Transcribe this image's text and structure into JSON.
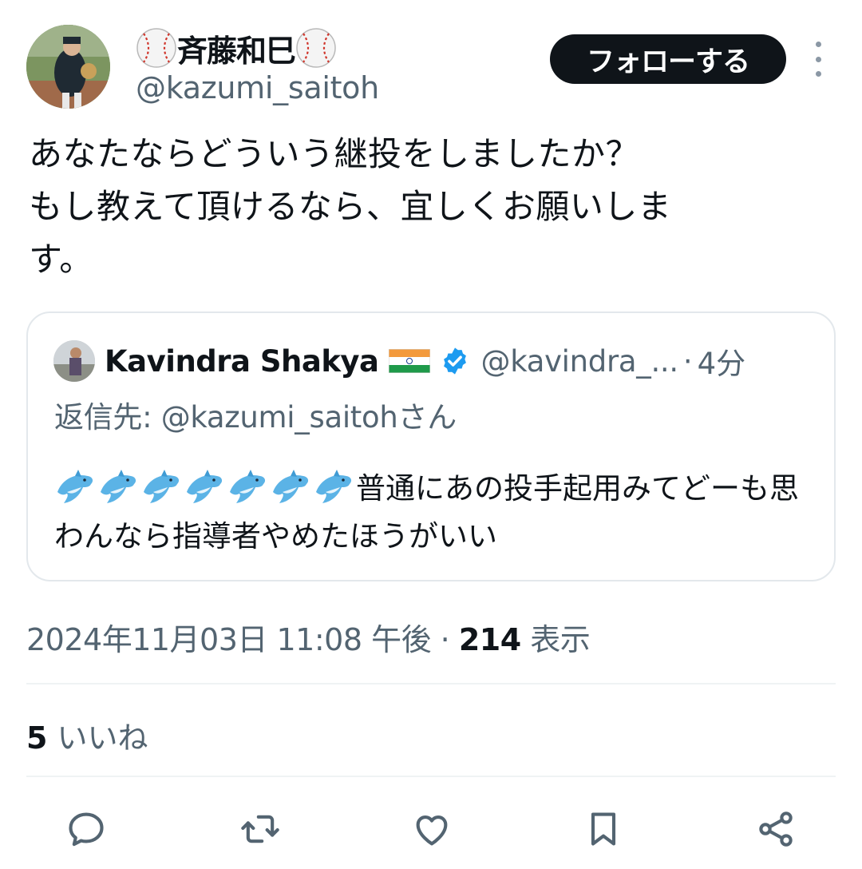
{
  "author": {
    "name": "斉藤和巳",
    "name_prefix_icon": "baseball-icon",
    "name_suffix_icon": "baseball-icon",
    "handle": "@kazumi_saitoh"
  },
  "follow_button": {
    "label": "フォローする"
  },
  "more_menu": {
    "icon": "more-vertical-icon"
  },
  "tweet": {
    "text": "あなたならどういう継投をしましたか？\nもし教えて頂けるなら、宜しくお願いしま\nす。"
  },
  "quote": {
    "name": "Kavindra Shakya",
    "flag_icon": "india-flag-icon",
    "verified_icon": "verified-badge-icon",
    "handle": "@kavindra_...",
    "separator": "·",
    "time": "4分",
    "reply_to": "返信先: @kazumi_saitohさん",
    "emoji_icon": "dolphin-icon",
    "emoji_count": 7,
    "text": "普通にあの投手起用みてどーも思わんなら指導者やめたほうがいい"
  },
  "meta": {
    "datetime": "2024年11月03日 11:08 午後",
    "separator": " · ",
    "views_count": "214",
    "views_label": " 表示"
  },
  "likes": {
    "count": "5",
    "label": " いいね"
  },
  "actions": [
    "reply-icon",
    "retweet-icon",
    "like-icon",
    "bookmark-icon",
    "share-icon"
  ],
  "colors": {
    "text": "#0f1419",
    "secondary": "#536471",
    "border": "#e3e8ec",
    "verified": "#1d9bf0",
    "button_bg": "#0f1419"
  }
}
